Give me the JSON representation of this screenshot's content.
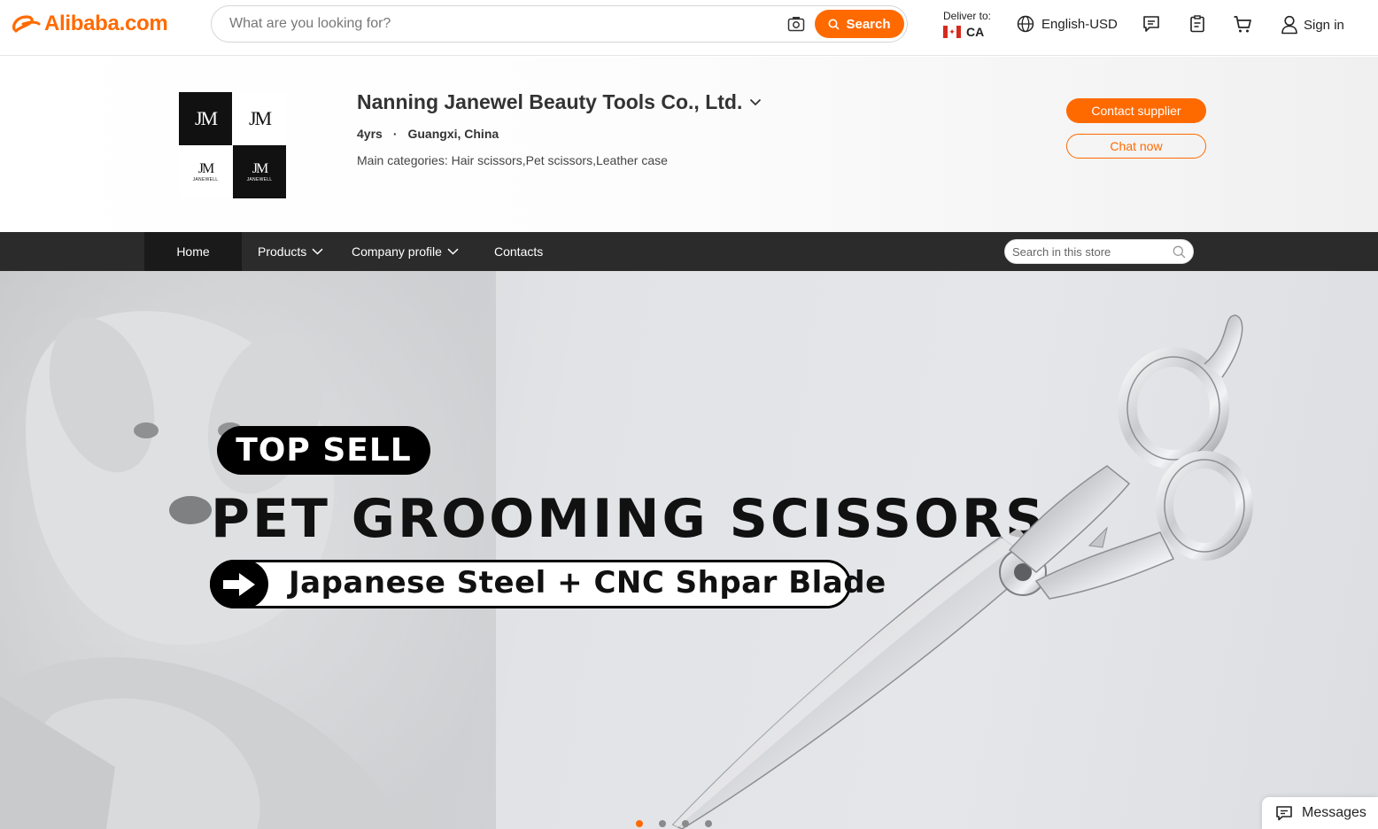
{
  "header": {
    "logo_text": "Alibaba.com",
    "search_placeholder": "What are you looking for?",
    "search_button": "Search",
    "deliver_label": "Deliver to:",
    "deliver_country": "CA",
    "language": "English-USD",
    "sign_in": "Sign in",
    "accent_color": "#ff6a00"
  },
  "supplier": {
    "name": "Nanning Janewel Beauty Tools Co., Ltd.",
    "years": "4yrs",
    "separator": "·",
    "location": "Guangxi, China",
    "main_categories": "Main categories: Hair scissors,Pet scissors,Leather case",
    "contact_button": "Contact supplier",
    "chat_button": "Chat now",
    "logo_monogram": "JM",
    "logo_small_text": "JANEWELL"
  },
  "store_nav": {
    "items": [
      {
        "label": "Home",
        "has_dropdown": false,
        "active": true
      },
      {
        "label": "Products",
        "has_dropdown": true
      },
      {
        "label": "Company profile",
        "has_dropdown": true
      },
      {
        "label": "Contacts",
        "has_dropdown": false
      }
    ],
    "search_placeholder": "Search in this store"
  },
  "banner": {
    "badge": "TOP SELL",
    "headline": "PET GROOMING SCISSORS",
    "subline": "Japanese Steel + CNC Shpar Blade",
    "slide_count": 4,
    "active_slide": 1
  },
  "messages_widget": {
    "label": "Messages"
  }
}
